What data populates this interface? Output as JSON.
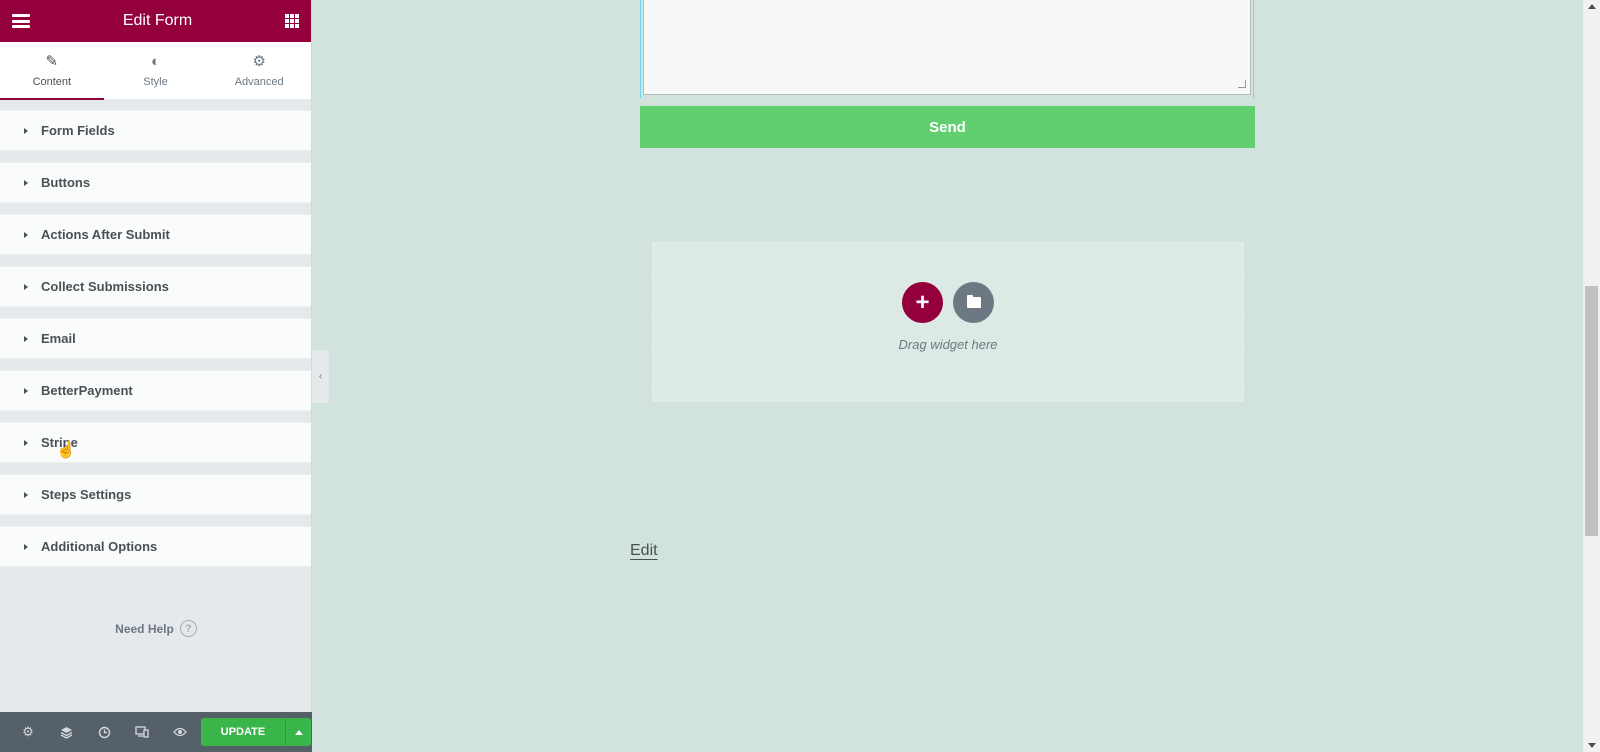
{
  "panel": {
    "title": "Edit Form",
    "tabs": [
      {
        "label": "Content",
        "icon": "pencil-icon",
        "active": true
      },
      {
        "label": "Style",
        "icon": "half-circle-icon",
        "active": false
      },
      {
        "label": "Advanced",
        "icon": "gear-icon",
        "active": false
      }
    ],
    "sections": [
      {
        "label": "Form Fields"
      },
      {
        "label": "Buttons"
      },
      {
        "label": "Actions After Submit"
      },
      {
        "label": "Collect Submissions"
      },
      {
        "label": "Email"
      },
      {
        "label": "BetterPayment"
      },
      {
        "label": "Stripe"
      },
      {
        "label": "Steps Settings"
      },
      {
        "label": "Additional Options"
      }
    ],
    "need_help": "Need Help",
    "help_glyph": "?",
    "footer": {
      "icons": [
        "settings-icon",
        "layers-icon",
        "history-icon",
        "responsive-icon",
        "eye-icon"
      ],
      "update_label": "UPDATE"
    }
  },
  "preview": {
    "send_label": "Send",
    "dropzone_text": "Drag widget here",
    "add_glyph": "+",
    "edit_link": "Edit"
  },
  "colors": {
    "brand": "#93003c",
    "send_green": "#61ce70",
    "update_green": "#39b54a",
    "canvas_bg": "#d1e3dc"
  }
}
